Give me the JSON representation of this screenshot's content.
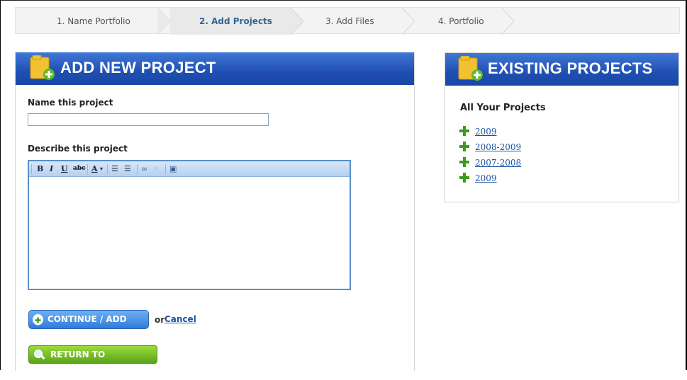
{
  "wizard": {
    "steps": [
      {
        "label": "1. Name Portfolio"
      },
      {
        "label": "2. Add Projects"
      },
      {
        "label": "3. Add Files"
      },
      {
        "label": "4. Portfolio"
      }
    ]
  },
  "add_project": {
    "title": "ADD NEW PROJECT",
    "name_label": "Name this project",
    "name_value": "",
    "describe_label": "Describe this project",
    "description_value": "",
    "toolbar": {
      "bold": "B",
      "italic": "I",
      "underline": "U",
      "strike": "abc",
      "font_color": "A",
      "ordered_list_icon": "ordered-list-icon",
      "unordered_list_icon": "unordered-list-icon",
      "link_icon": "link-icon",
      "unlink_icon": "unlink-icon",
      "source_icon": "source-icon"
    },
    "continue_button": "CONTINUE / ADD FILES",
    "or_text": "or",
    "cancel_link": "Cancel",
    "return_button": "RETURN TO PORTFOLIO"
  },
  "existing_projects": {
    "title": "EXISTING PROJECTS",
    "subtitle": "All Your Projects",
    "projects": [
      "2009",
      "2008-2009",
      "2007-2008",
      "2009"
    ]
  },
  "colors": {
    "header_blue": "#1f4fb2",
    "link_blue": "#1c53a3",
    "continue_blue": "#2f7bd8",
    "return_green": "#5aa419",
    "plus_green": "#3d9a1b"
  }
}
